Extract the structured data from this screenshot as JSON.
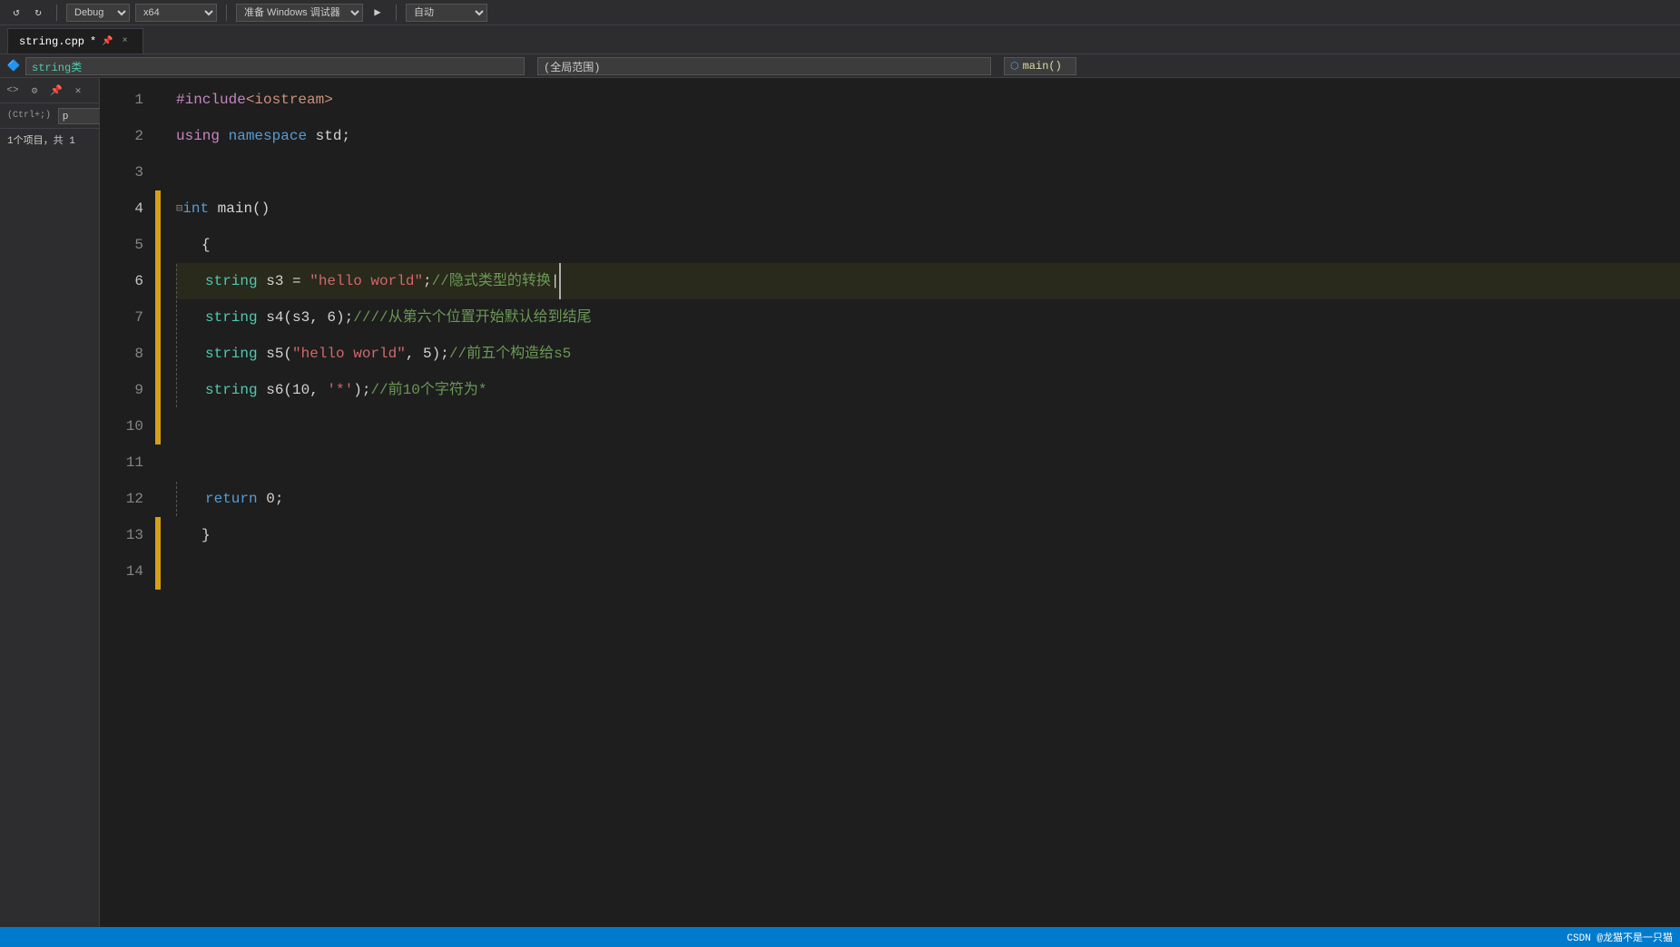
{
  "toolbar": {
    "debug_label": "Debug",
    "config_label": "x64",
    "platform_label": "准备 Windows 调试器",
    "auto_label": "自动"
  },
  "tab": {
    "filename": "string.cpp",
    "modified": true,
    "close_icon": "×"
  },
  "navbar": {
    "class_label": "string类",
    "scope_label": "(全局范围)",
    "func_icon": "⬡",
    "func_label": "main()"
  },
  "sidebar": {
    "shortcut": "(Ctrl+;)",
    "search_placeholder": "p",
    "tree_item": "1个项目，共 1"
  },
  "lines": [
    {
      "num": 1,
      "content": "#include<iostream>",
      "type": "include"
    },
    {
      "num": 2,
      "content": "using namespace std;",
      "type": "using"
    },
    {
      "num": 3,
      "content": "",
      "type": "empty"
    },
    {
      "num": 4,
      "content": "int main()",
      "type": "function",
      "fold": true
    },
    {
      "num": 5,
      "content": "{",
      "type": "brace"
    },
    {
      "num": 6,
      "content": "    string s3 = \"hello world\";//隐式类型的转换",
      "type": "code",
      "cursor": true
    },
    {
      "num": 7,
      "content": "    string s4(s3, 6);////从第六个位置开始默认给到结尾",
      "type": "code"
    },
    {
      "num": 8,
      "content": "    string s5(\"hello world\", 5);//前五个构造给s5",
      "type": "code"
    },
    {
      "num": 9,
      "content": "    string s6(10, '*');//前10个字符为*",
      "type": "code"
    },
    {
      "num": 10,
      "content": "",
      "type": "empty"
    },
    {
      "num": 11,
      "content": "",
      "type": "empty"
    },
    {
      "num": 12,
      "content": "    return 0;",
      "type": "return"
    },
    {
      "num": 13,
      "content": "}",
      "type": "brace"
    },
    {
      "num": 14,
      "content": "",
      "type": "empty"
    }
  ],
  "status": {
    "credit": "CSDN @龙猫不是一只猫"
  }
}
